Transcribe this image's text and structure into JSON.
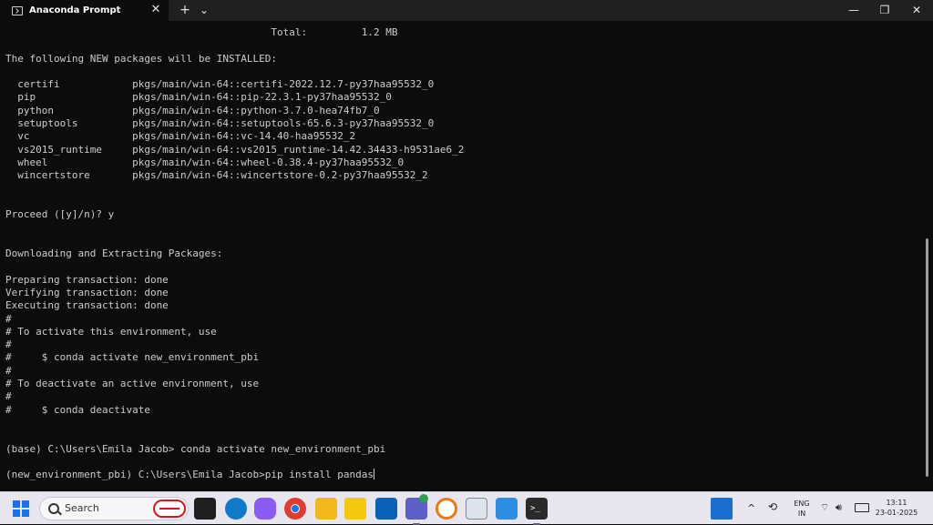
{
  "window": {
    "tab_title": "Anaconda Prompt",
    "tab_close": "✕",
    "new_tab": "+",
    "tab_dropdown": "⌄",
    "minimize": "—",
    "maximize": "❐",
    "close": "✕"
  },
  "terminal": {
    "lines": [
      "                                            Total:         1.2 MB",
      "",
      "The following NEW packages will be INSTALLED:",
      "",
      "  certifi            pkgs/main/win-64::certifi-2022.12.7-py37haa95532_0",
      "  pip                pkgs/main/win-64::pip-22.3.1-py37haa95532_0",
      "  python             pkgs/main/win-64::python-3.7.0-hea74fb7_0",
      "  setuptools         pkgs/main/win-64::setuptools-65.6.3-py37haa95532_0",
      "  vc                 pkgs/main/win-64::vc-14.40-haa95532_2",
      "  vs2015_runtime     pkgs/main/win-64::vs2015_runtime-14.42.34433-h9531ae6_2",
      "  wheel              pkgs/main/win-64::wheel-0.38.4-py37haa95532_0",
      "  wincertstore       pkgs/main/win-64::wincertstore-0.2-py37haa95532_2",
      "",
      "",
      "Proceed ([y]/n)? y",
      "",
      "",
      "Downloading and Extracting Packages:",
      "",
      "Preparing transaction: done",
      "Verifying transaction: done",
      "Executing transaction: done",
      "#",
      "# To activate this environment, use",
      "#",
      "#     $ conda activate new_environment_pbi",
      "#",
      "# To deactivate an active environment, use",
      "#",
      "#     $ conda deactivate",
      "",
      "",
      "(base) C:\\Users\\Emila Jacob> conda activate new_environment_pbi",
      "",
      "(new_environment_pbi) C:\\Users\\Emila Jacob>pip install pandas"
    ]
  },
  "taskbar": {
    "search_placeholder": "Search",
    "apps": [
      "file-explorer-icon",
      "edge-icon",
      "copilot-icon",
      "chrome-icon",
      "folder-icon",
      "power-bi-icon",
      "outlook-icon",
      "teams-icon",
      "notes-icon",
      "notepad-icon",
      "paint-icon",
      "terminal-icon"
    ],
    "language_line1": "ENG",
    "language_line2": "IN",
    "time": "13:11",
    "date": "23-01-2025",
    "colors": {
      "accent": "#1a73e8",
      "terminal_bg": "#0c0c0c",
      "taskbar_bg": "#e8e7ef"
    }
  }
}
